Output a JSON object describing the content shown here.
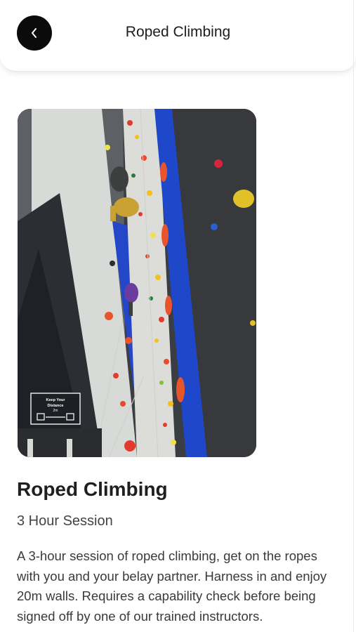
{
  "header": {
    "title": "Roped Climbing"
  },
  "hero_image": {
    "description": "Indoor climbing wall",
    "wall_sign_text": [
      "Keep Your",
      "Distance",
      "2m"
    ]
  },
  "activity": {
    "title": "Roped Climbing",
    "subtitle": "3 Hour Session",
    "description": "A 3-hour session of roped climbing, get on the ropes with you and your belay partner. Harness in and enjoy 20m walls. Requires a capability check before being signed off by one of our trained instructors."
  },
  "icons": {
    "back": "chevron-left-icon"
  },
  "colors": {
    "back_button": "#0b0b0b",
    "wall_blue": "#1f47c9"
  }
}
